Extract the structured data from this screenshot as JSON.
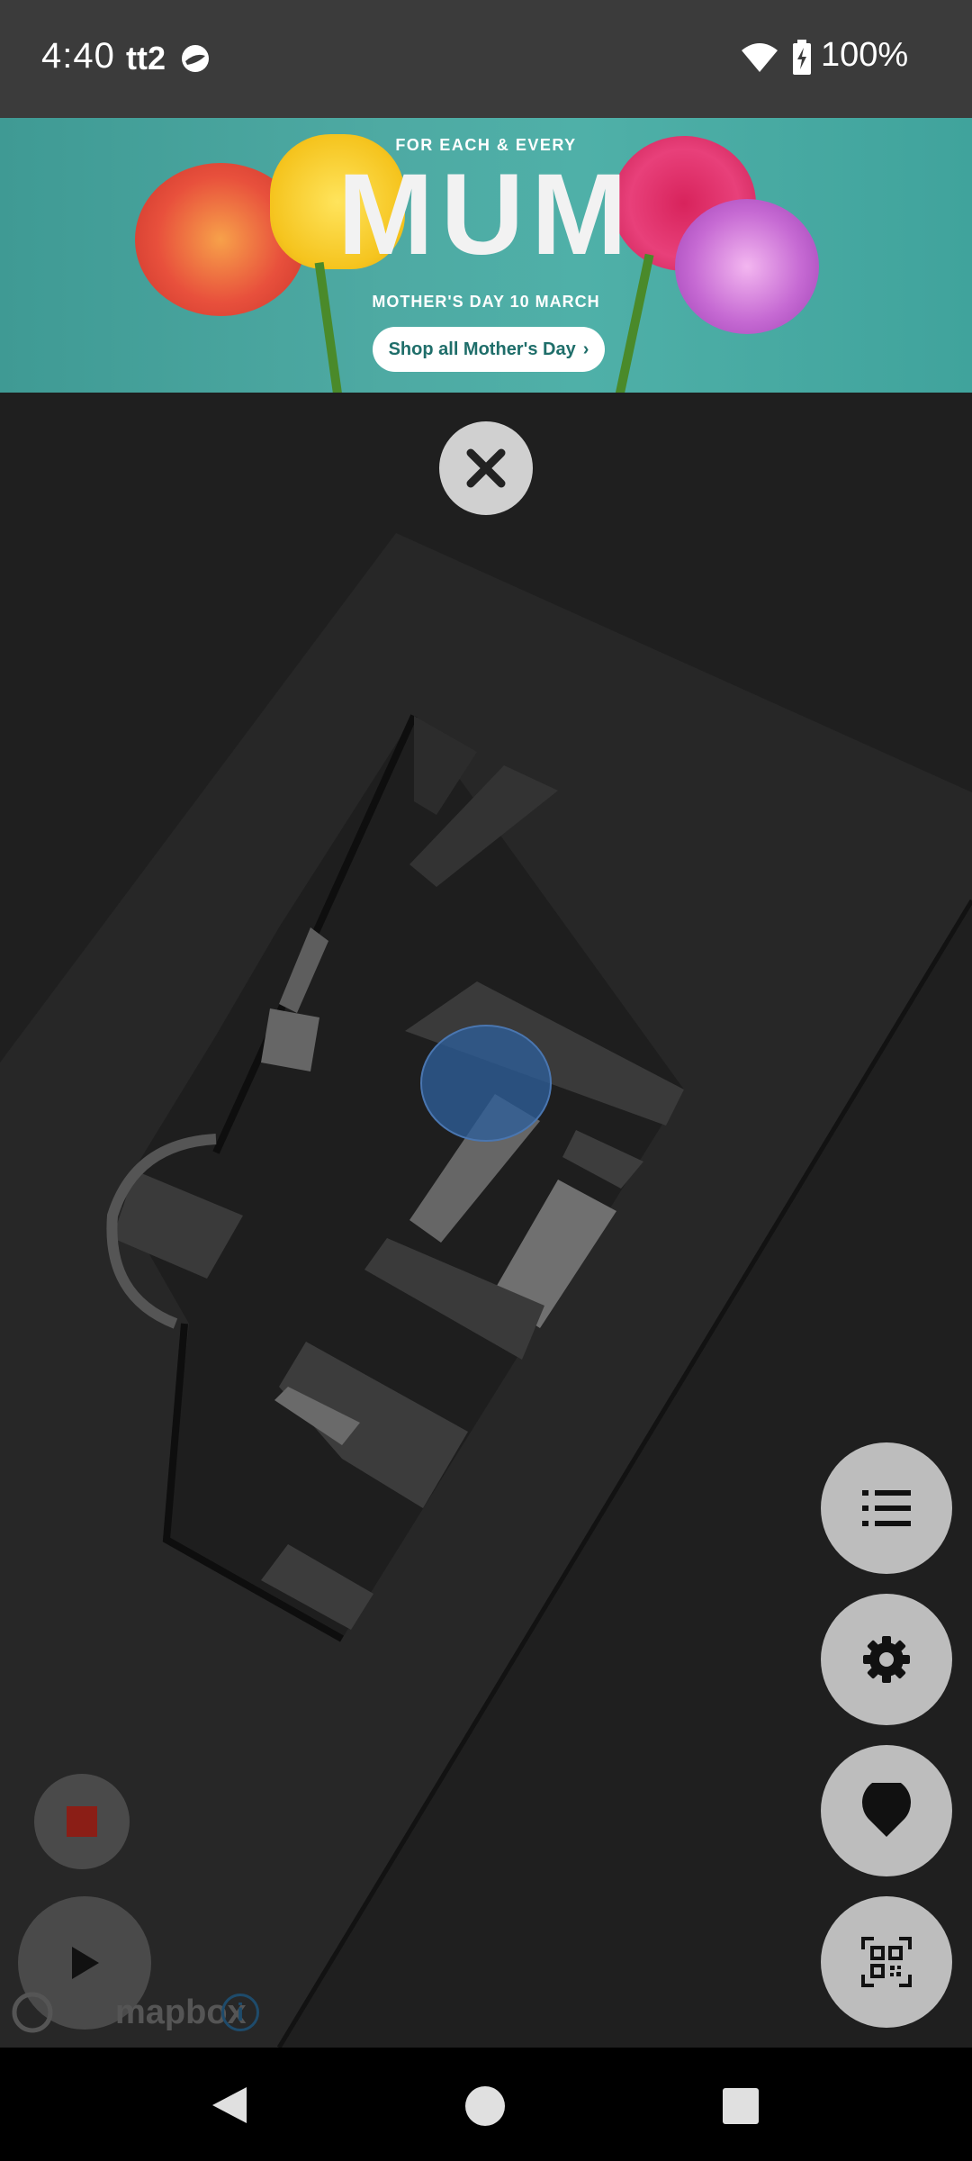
{
  "status_bar": {
    "time": "4:40",
    "carrier": "tt2",
    "battery_percent": "100%",
    "icons": [
      "app-notification-icon",
      "wifi-icon",
      "battery-charging-icon"
    ]
  },
  "banner": {
    "eyebrow": "FOR EACH & EVERY",
    "headline": "MUM",
    "subline": "MOTHER'S DAY 10 MARCH",
    "cta_label": "Shop all Mother's Day",
    "cta_chevron": "›",
    "background_color": "#4eaaa3"
  },
  "map": {
    "attribution_logo": "mapbox",
    "info_glyph": "i",
    "user_location_color": "#2e5f9a"
  },
  "controls": {
    "close": "close-icon",
    "list": "list-icon",
    "settings": "gear-icon",
    "location": "location-pin-icon",
    "qr": "qr-scan-icon",
    "stop": "stop-icon",
    "play": "play-icon",
    "stop_color": "#8b1e16"
  },
  "navigation": {
    "back": "back-icon",
    "home": "home-icon",
    "recents": "recents-icon"
  }
}
